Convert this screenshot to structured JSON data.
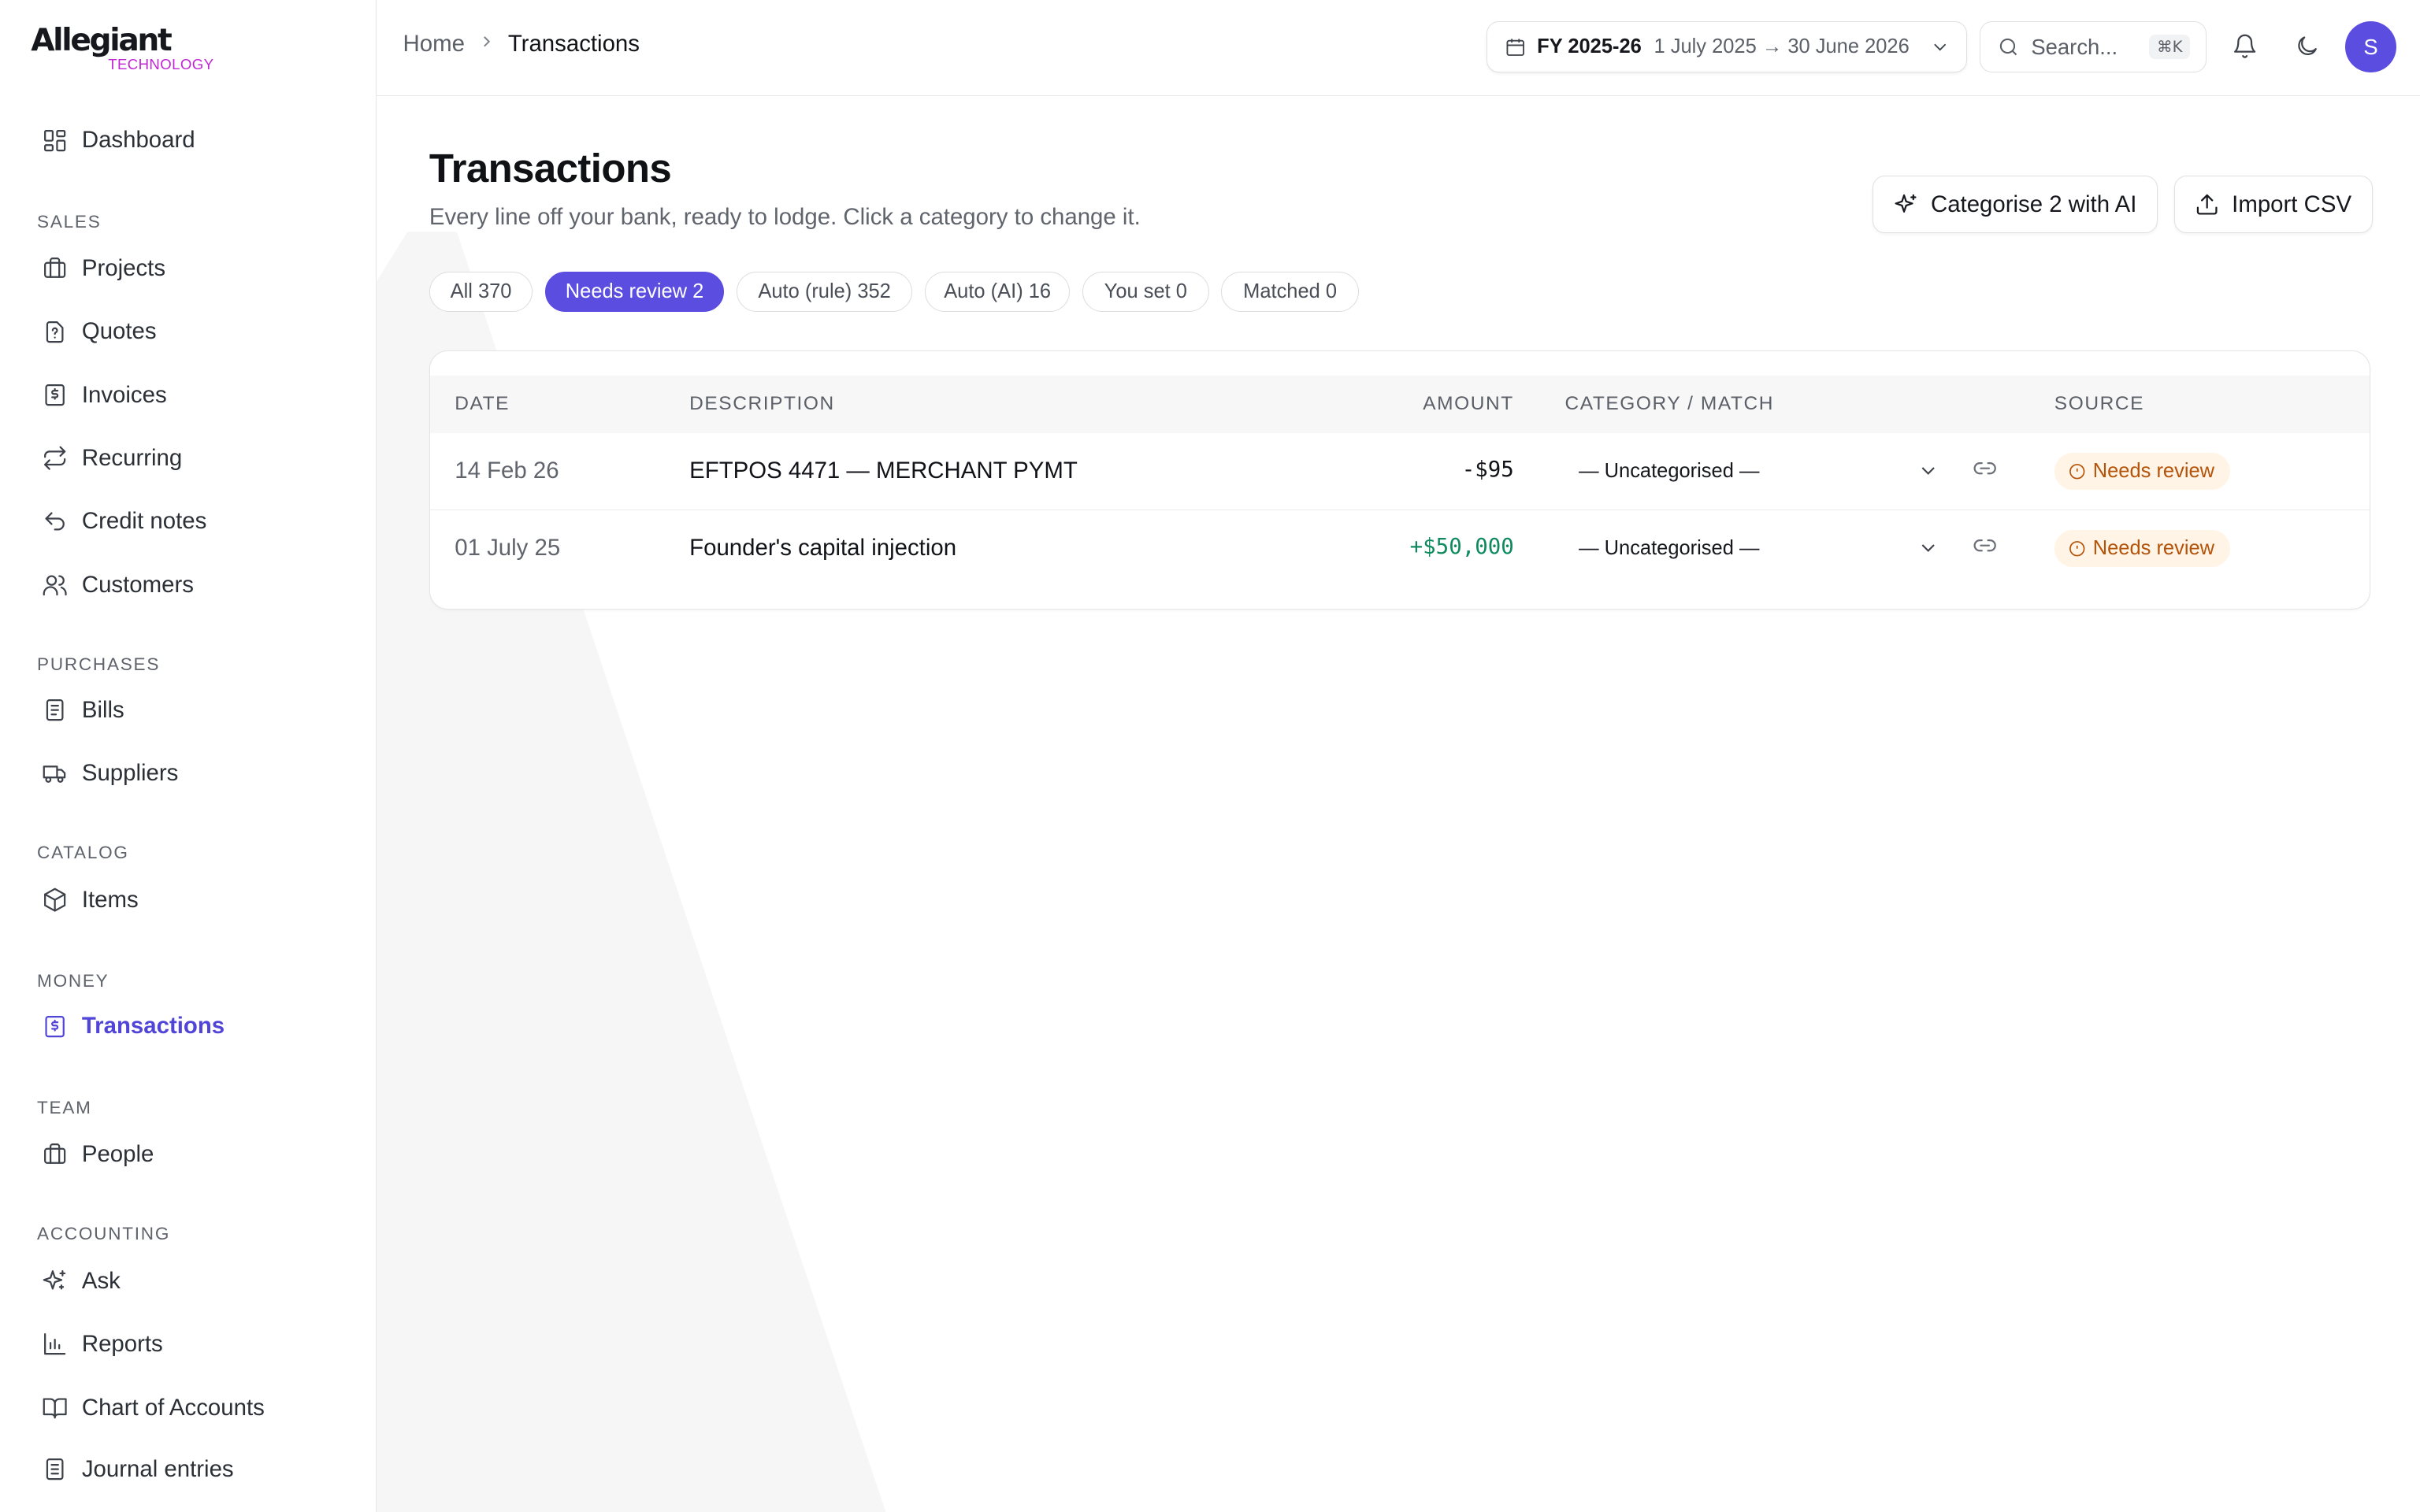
{
  "brand": {
    "name": "Allegiant",
    "sub": "TECHNOLOGY"
  },
  "sidebar": {
    "dashboard": "Dashboard",
    "sections": {
      "sales": "SALES",
      "purchases": "PURCHASES",
      "catalog": "CATALOG",
      "money": "MONEY",
      "team": "TEAM",
      "accounting": "ACCOUNTING"
    },
    "items": {
      "projects": "Projects",
      "quotes": "Quotes",
      "invoices": "Invoices",
      "recurring": "Recurring",
      "credit_notes": "Credit notes",
      "customers": "Customers",
      "bills": "Bills",
      "suppliers": "Suppliers",
      "items": "Items",
      "transactions": "Transactions",
      "people": "People",
      "ask": "Ask",
      "reports": "Reports",
      "chart_of_accounts": "Chart of Accounts",
      "journal_entries": "Journal entries"
    },
    "active": "transactions",
    "accent": "#5145d8"
  },
  "header": {
    "breadcrumb": {
      "home": "Home",
      "current": "Transactions"
    },
    "fy": {
      "label": "FY 2025-26",
      "range": "1 July 2025 → 30 June 2026"
    },
    "search": {
      "placeholder": "Search...",
      "shortcut": "⌘K"
    },
    "avatar_initial": "S"
  },
  "page": {
    "title": "Transactions",
    "subtitle": "Every line off your bank, ready to lodge. Click a category to change it.",
    "actions": {
      "categorise": "Categorise 2 with AI",
      "import": "Import CSV"
    },
    "filters": [
      {
        "label": "All 370",
        "active": false
      },
      {
        "label": "Needs review 2",
        "active": true
      },
      {
        "label": "Auto (rule) 352",
        "active": false
      },
      {
        "label": "Auto (AI) 16",
        "active": false
      },
      {
        "label": "You set 0",
        "active": false
      },
      {
        "label": "Matched 0",
        "active": false
      }
    ]
  },
  "table": {
    "columns": {
      "date": "DATE",
      "description": "DESCRIPTION",
      "amount": "AMOUNT",
      "category": "CATEGORY / MATCH",
      "source": "SOURCE"
    },
    "rows": [
      {
        "date": "14 Feb 26",
        "description": "EFTPOS 4471 — MERCHANT PYMT",
        "amount": "-$95",
        "category": "— Uncategorised —",
        "source": "Needs review"
      },
      {
        "date": "01 July 25",
        "description": "Founder's capital injection",
        "amount": "+$50,000",
        "category": "— Uncategorised —",
        "source": "Needs review"
      }
    ],
    "colors": {
      "positive": "#0f8a5f",
      "review_bg": "#fff4e5",
      "review_text": "#b4530a"
    }
  }
}
